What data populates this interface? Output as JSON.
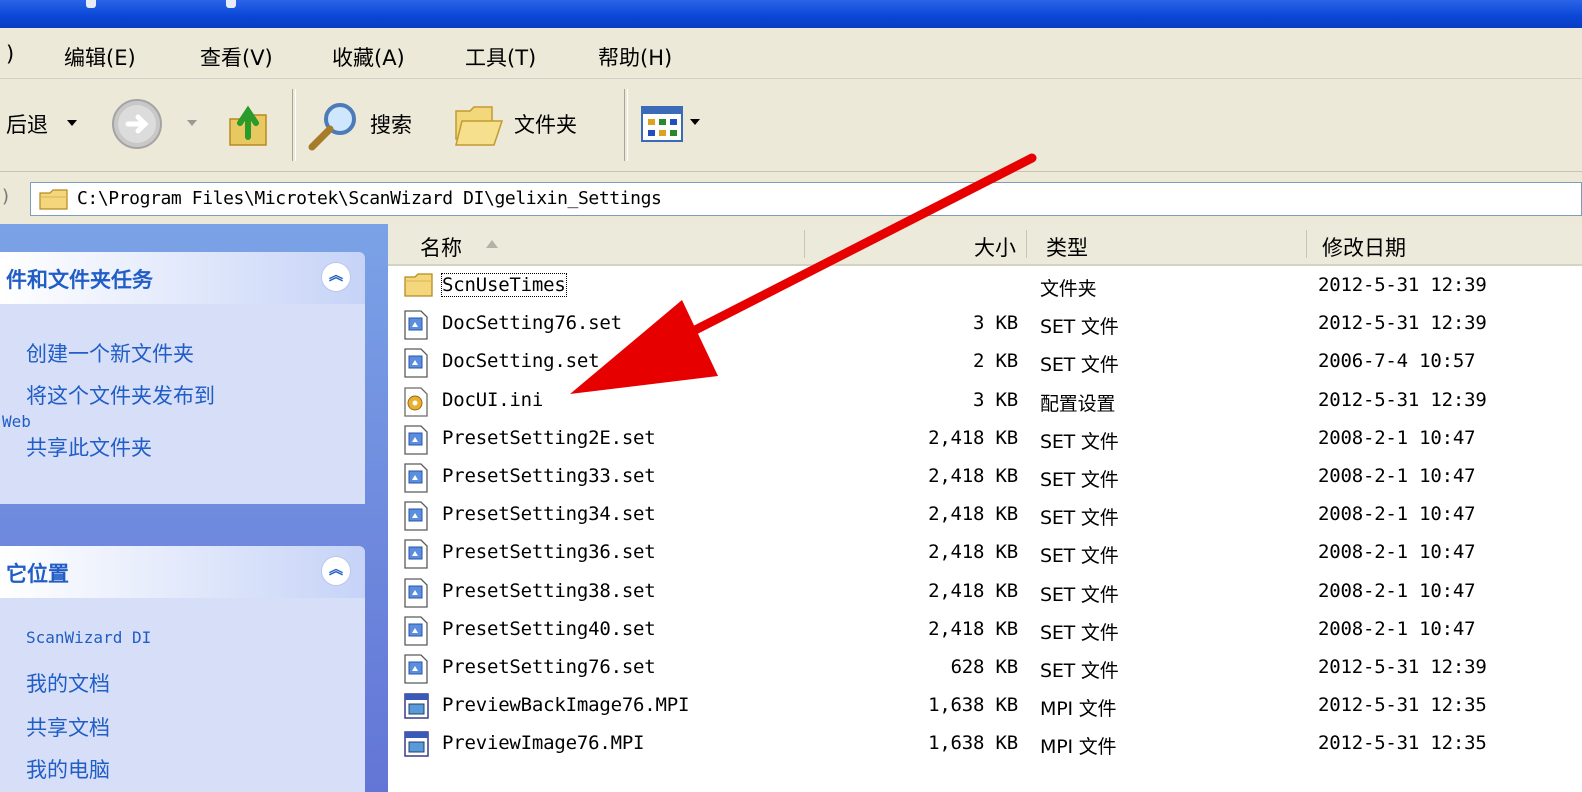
{
  "menubar": {
    "items": [
      ")",
      "编辑(E)",
      "查看(V)",
      "收藏(A)",
      "工具(T)",
      "帮助(H)"
    ]
  },
  "toolbar": {
    "back_label": "后退",
    "search_label": "搜索",
    "folders_label": "文件夹"
  },
  "address": {
    "path": "C:\\Program Files\\Microtek\\ScanWizard DI\\gelixin_Settings"
  },
  "taskpane": {
    "file_tasks": {
      "title": "件和文件夹任务",
      "links": [
        "创建一个新文件夹",
        "将这个文件夹发布到",
        "Web",
        "共享此文件夹"
      ]
    },
    "other_places": {
      "title": "它位置",
      "links": [
        "ScanWizard DI",
        "我的文档",
        "共享文档",
        "我的电脑"
      ]
    }
  },
  "filelist": {
    "columns": {
      "name": "名称",
      "size": "大小",
      "type": "类型",
      "modified": "修改日期"
    },
    "rows": [
      {
        "name": "ScnUseTimes",
        "size": "",
        "type": "文件夹",
        "modified": "2012-5-31 12:39",
        "icon": "folder-icon"
      },
      {
        "name": "DocSetting76.set",
        "size": "3 KB",
        "type": "SET 文件",
        "modified": "2012-5-31 12:39",
        "icon": "set-file-icon"
      },
      {
        "name": "DocSetting.set",
        "size": "2 KB",
        "type": "SET 文件",
        "modified": "2006-7-4 10:57",
        "icon": "set-file-icon"
      },
      {
        "name": "DocUI.ini",
        "size": "3 KB",
        "type": "配置设置",
        "modified": "2012-5-31 12:39",
        "icon": "ini-file-icon"
      },
      {
        "name": "PresetSetting2E.set",
        "size": "2,418 KB",
        "type": "SET 文件",
        "modified": "2008-2-1 10:47",
        "icon": "set-file-icon"
      },
      {
        "name": "PresetSetting33.set",
        "size": "2,418 KB",
        "type": "SET 文件",
        "modified": "2008-2-1 10:47",
        "icon": "set-file-icon"
      },
      {
        "name": "PresetSetting34.set",
        "size": "2,418 KB",
        "type": "SET 文件",
        "modified": "2008-2-1 10:47",
        "icon": "set-file-icon"
      },
      {
        "name": "PresetSetting36.set",
        "size": "2,418 KB",
        "type": "SET 文件",
        "modified": "2008-2-1 10:47",
        "icon": "set-file-icon"
      },
      {
        "name": "PresetSetting38.set",
        "size": "2,418 KB",
        "type": "SET 文件",
        "modified": "2008-2-1 10:47",
        "icon": "set-file-icon"
      },
      {
        "name": "PresetSetting40.set",
        "size": "2,418 KB",
        "type": "SET 文件",
        "modified": "2008-2-1 10:47",
        "icon": "set-file-icon"
      },
      {
        "name": "PresetSetting76.set",
        "size": "628 KB",
        "type": "SET 文件",
        "modified": "2012-5-31 12:39",
        "icon": "set-file-icon"
      },
      {
        "name": "PreviewBackImage76.MPI",
        "size": "1,638 KB",
        "type": "MPI 文件",
        "modified": "2012-5-31 12:35",
        "icon": "mpi-file-icon"
      },
      {
        "name": "PreviewImage76.MPI",
        "size": "1,638 KB",
        "type": "MPI 文件",
        "modified": "2012-5-31 12:35",
        "icon": "mpi-file-icon"
      }
    ]
  },
  "colors": {
    "titlebar": "#0a46d6",
    "chrome": "#ece9d8",
    "taskpane_link": "#215dc6",
    "annotation_arrow": "#e60000"
  }
}
